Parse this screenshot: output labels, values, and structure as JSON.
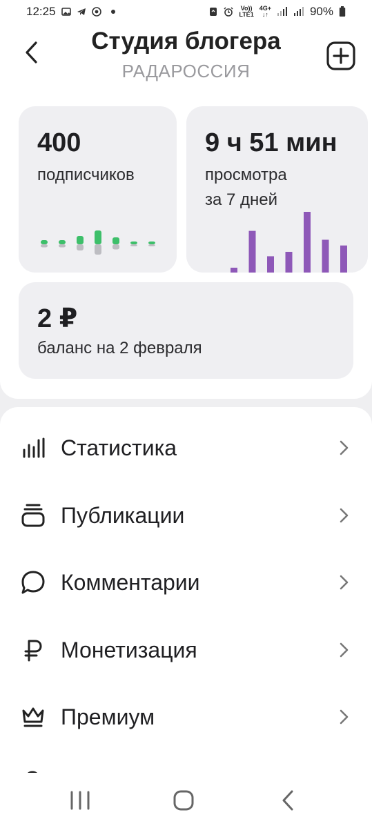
{
  "status_bar": {
    "time": "12:25",
    "net_top": "Vo))",
    "net_bottom": "LTE1",
    "gen_top": "4G+",
    "battery": "90%"
  },
  "header": {
    "title": "Студия блогера",
    "subtitle": "РАДАРОССИЯ"
  },
  "stats": {
    "subscribers": {
      "value": "400",
      "label": "подписчиков",
      "trend": [
        0.3,
        0.3,
        0.6,
        1.0,
        0.5,
        0.2,
        0.2
      ]
    },
    "views": {
      "value": "9 ч 51 мин",
      "label_line1": "просмотра",
      "label_line2": "за 7 дней",
      "bars": [
        0.12,
        0.7,
        0.3,
        0.37,
        1.0,
        0.56,
        0.47
      ]
    },
    "balance": {
      "value": "2 ₽",
      "label": "баланс на 2 февраля"
    }
  },
  "menu": {
    "items": [
      {
        "label": "Статистика",
        "icon": "bar-chart-icon"
      },
      {
        "label": "Публикации",
        "icon": "stack-icon"
      },
      {
        "label": "Комментарии",
        "icon": "comment-icon"
      },
      {
        "label": "Монетизация",
        "icon": "ruble-icon"
      },
      {
        "label": "Премиум",
        "icon": "crown-icon"
      }
    ]
  },
  "colors": {
    "accent_green": "#3dbf6a",
    "accent_purple": "#8e58b8",
    "card_bg": "#efeff2"
  }
}
